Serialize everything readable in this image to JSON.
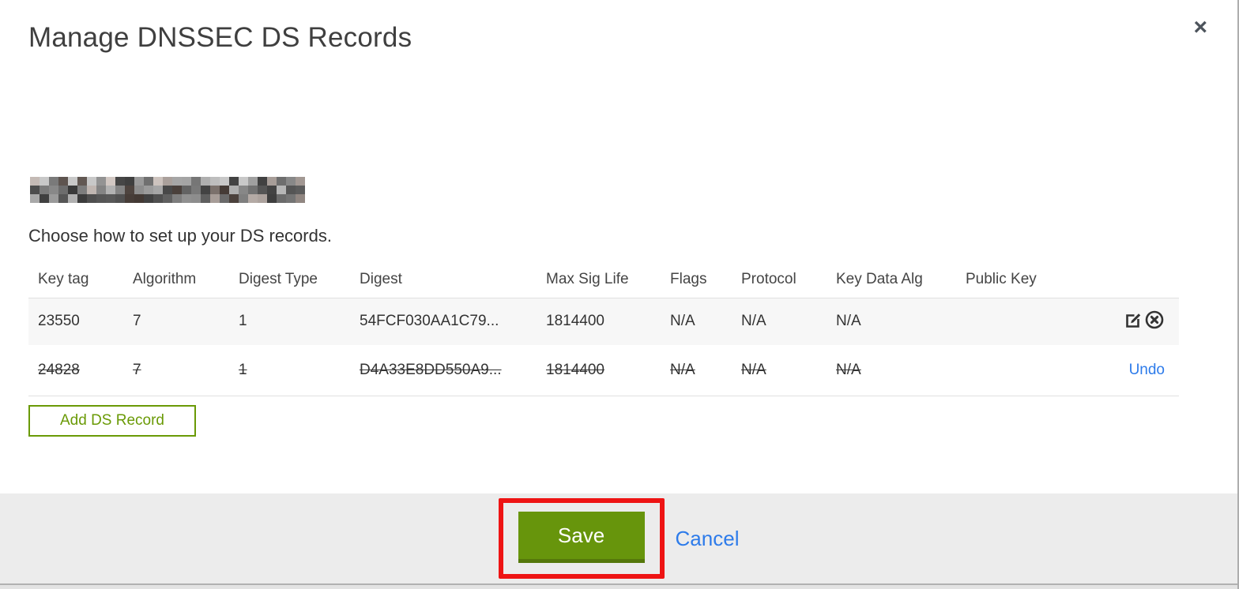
{
  "modal": {
    "title": "Manage DNSSEC DS Records",
    "close_icon": "×",
    "intro": "Choose how to set up your DS records.",
    "domain_redacted": true,
    "table": {
      "headers": [
        "Key tag",
        "Algorithm",
        "Digest Type",
        "Digest",
        "Max Sig Life",
        "Flags",
        "Protocol",
        "Key Data Alg",
        "Public Key"
      ],
      "rows": [
        {
          "key_tag": "23550",
          "algorithm": "7",
          "digest_type": "1",
          "digest": "54FCF030AA1C79...",
          "max_sig_life": "1814400",
          "flags": "N/A",
          "protocol": "N/A",
          "key_data_alg": "N/A",
          "public_key": "",
          "state": "normal",
          "actions": [
            "edit",
            "delete"
          ]
        },
        {
          "key_tag": "24828",
          "algorithm": "7",
          "digest_type": "1",
          "digest": "D4A33E8DD550A9...",
          "max_sig_life": "1814400",
          "flags": "N/A",
          "protocol": "N/A",
          "key_data_alg": "N/A",
          "public_key": "",
          "state": "deleted",
          "undo_label": "Undo"
        }
      ]
    },
    "add_button_label": "Add DS Record",
    "footer": {
      "save_label": "Save",
      "cancel_label": "Cancel"
    }
  },
  "icons": {
    "close": "x-mark",
    "edit": "pencil-in-square",
    "delete": "x-in-circle"
  },
  "colors": {
    "accent_green": "#67950c",
    "green_outline": "#6a9a06",
    "link_blue": "#2d7bea",
    "annotation_red": "#ee1414",
    "footer_gray": "#ececec",
    "row_gray": "#f7f7f7"
  }
}
